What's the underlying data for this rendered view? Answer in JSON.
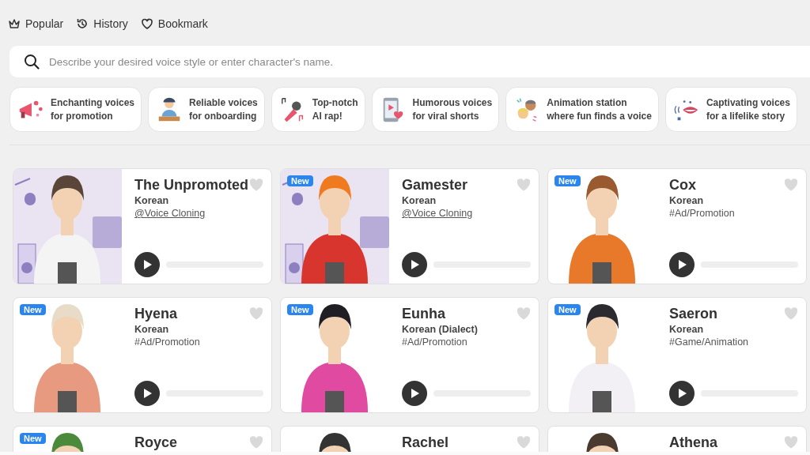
{
  "nav": [
    {
      "label": "Popular",
      "selected": false
    },
    {
      "label": "History",
      "selected": false
    },
    {
      "label": "Bookmark",
      "selected": false
    }
  ],
  "search": {
    "placeholder": "Describe your desired voice style or enter character's name."
  },
  "categories": [
    {
      "label": "Enchanting voices\nfor promotion"
    },
    {
      "label": "Reliable voices\nfor onboarding"
    },
    {
      "label": "Top-notch\nAI rap!"
    },
    {
      "label": "Humorous voices\nfor viral shorts"
    },
    {
      "label": "Animation station\nwhere fun finds a voice"
    },
    {
      "label": "Captivating voices\nfor a lifelike story"
    }
  ],
  "voices": [
    {
      "name": "The Unpromoted",
      "language": "Korean",
      "tag": {
        "text": "@Voice Cloning",
        "kind": "link"
      },
      "bookmarked": false
    },
    {
      "name": "Gamester",
      "language": "Korean",
      "tag": {
        "text": "@Voice Cloning",
        "kind": "link"
      },
      "badge": "New",
      "bookmarked": false
    },
    {
      "name": "Cox",
      "language": "Korean",
      "tag": {
        "text": "#Ad/Promotion",
        "kind": "hashtag"
      },
      "badge": "New",
      "bookmarked": false
    },
    {
      "name": "Hyena",
      "language": "Korean",
      "tag": {
        "text": "#Ad/Promotion",
        "kind": "hashtag"
      },
      "badge": "New",
      "bookmarked": false
    },
    {
      "name": "Eunha",
      "language": "Korean (Dialect)",
      "tag": {
        "text": "#Ad/Promotion",
        "kind": "hashtag"
      },
      "badge": "New",
      "bookmarked": false
    },
    {
      "name": "Saeron",
      "language": "Korean",
      "tag": {
        "text": "#Game/Animation",
        "kind": "hashtag"
      },
      "badge": "New",
      "bookmarked": false
    },
    {
      "name": "Royce",
      "badge": "New",
      "bookmarked": false
    },
    {
      "name": "Rachel",
      "bookmarked": false
    },
    {
      "name": "Athena",
      "bookmarked": false
    }
  ]
}
